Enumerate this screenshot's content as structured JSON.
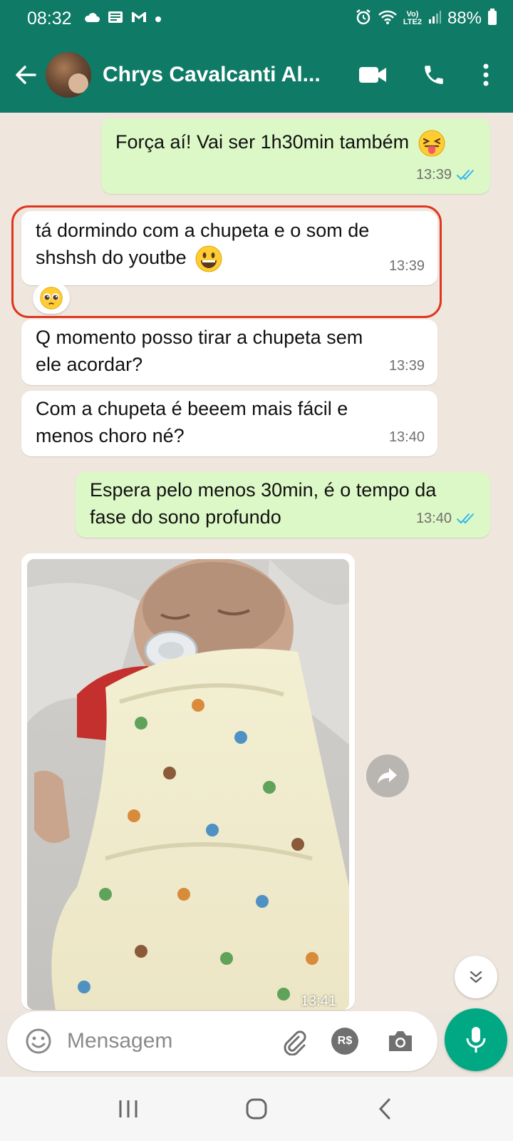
{
  "status_bar": {
    "time": "08:32",
    "battery": "88%",
    "network": "LTE2",
    "icons": [
      "cloud-icon",
      "news-icon",
      "gmail-icon",
      "dot-icon",
      "alarm-icon",
      "wifi-icon",
      "volte-icon",
      "signal-icon",
      "battery-icon"
    ]
  },
  "header": {
    "contact_name": "Chrys Cavalcanti Al...",
    "icons": [
      "back-arrow-icon",
      "video-call-icon",
      "phone-icon",
      "more-vert-icon"
    ]
  },
  "messages": [
    {
      "direction": "out",
      "text": "Força aí! Vai ser 1h30min também",
      "emoji": "squinting-face-tongue",
      "time": "13:39",
      "status": "read"
    },
    {
      "direction": "in",
      "text_line1": "tá dormindo com a chupeta e o som de",
      "text_line2": "shshsh do youtbe",
      "emoji": "grinning-face",
      "time": "13:39",
      "reaction": "pleading-face",
      "highlighted": true
    },
    {
      "direction": "in",
      "text_line1": "Q momento posso tirar a chupeta sem",
      "text_line2": "ele acordar?",
      "time": "13:39"
    },
    {
      "direction": "in",
      "text_line1": "Com a chupeta é beeem mais fácil e",
      "text_line2": "menos choro né?",
      "time": "13:40"
    },
    {
      "direction": "out",
      "text_line1": "Espera pelo menos 30min, é o tempo da",
      "text_line2": "fase do sono profundo",
      "time": "13:40",
      "status": "read"
    },
    {
      "direction": "in",
      "type": "image",
      "image_desc": "sleeping baby swaddled with pacifier",
      "time": "13:41"
    }
  ],
  "input": {
    "placeholder": "Mensagem",
    "icons": [
      "emoji-icon",
      "attach-icon",
      "payment-icon",
      "camera-icon",
      "mic-icon"
    ],
    "payment_label": "R$"
  },
  "nav": {
    "icons": [
      "recents-icon",
      "home-icon",
      "back-icon"
    ]
  },
  "colors": {
    "header": "#0f7a66",
    "outgoing_bubble": "#dcf8c6",
    "incoming_bubble": "#ffffff",
    "read_ticks": "#34b7f1",
    "mic_button": "#00a884",
    "highlight": "#e03520"
  }
}
